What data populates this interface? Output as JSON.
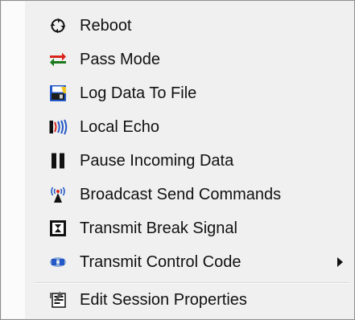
{
  "menu": {
    "items": [
      {
        "label": "Reboot",
        "icon": "reboot-icon",
        "interactable": true
      },
      {
        "label": "Pass Mode",
        "icon": "pass-mode-arrows-icon",
        "interactable": true
      },
      {
        "label": "Log Data To File",
        "icon": "log-file-icon",
        "interactable": true
      },
      {
        "label": "Local Echo",
        "icon": "local-echo-icon",
        "interactable": true
      },
      {
        "label": "Pause Incoming Data",
        "icon": "pause-icon",
        "interactable": true
      },
      {
        "label": "Broadcast Send Commands",
        "icon": "broadcast-antenna-icon",
        "interactable": true
      },
      {
        "label": "Transmit Break Signal",
        "icon": "break-signal-icon",
        "interactable": true
      },
      {
        "label": "Transmit Control Code",
        "icon": "control-code-icon",
        "interactable": true,
        "submenu": true
      },
      {
        "label": "Edit Session Properties",
        "icon": "session-properties-icon",
        "interactable": true
      }
    ]
  },
  "colors": {
    "menu_background": "#f0f0f0",
    "left_bar": "#fbfbfb",
    "border": "#8e8e8e",
    "text": "#111111",
    "pass_red": "#d9261c",
    "pass_green": "#1a7a1a",
    "icon_blue": "#2458c7",
    "icon_black": "#111111"
  }
}
